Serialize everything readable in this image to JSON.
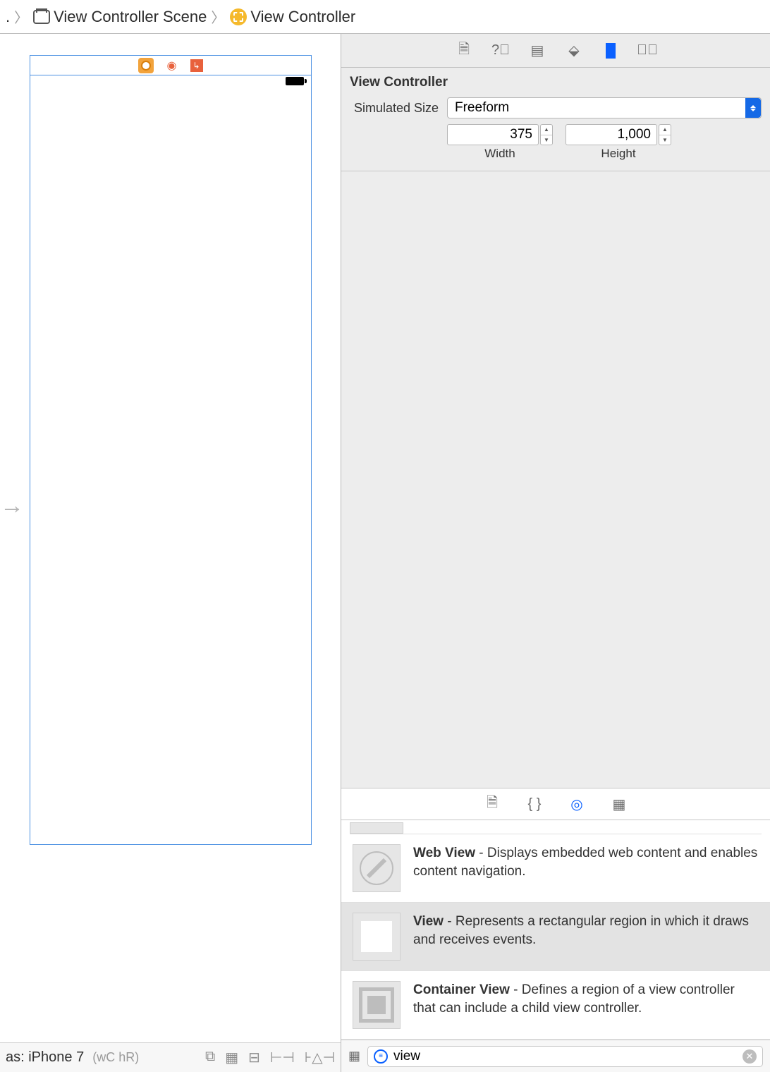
{
  "breadcrumb": {
    "leading_sep": ".",
    "scene": "View Controller Scene",
    "item": "View Controller"
  },
  "canvas": {
    "footer_device": "as: iPhone 7",
    "footer_traits": "(wC hR)"
  },
  "inspector": {
    "title": "View Controller",
    "sim_size_label": "Simulated Size",
    "sim_size_value": "Freeform",
    "width_value": "375",
    "height_value": "1,000",
    "width_label": "Width",
    "height_label": "Height"
  },
  "library": {
    "items": [
      {
        "name": "Web View",
        "desc": " - Displays embedded web content and enables content navigation."
      },
      {
        "name": "View",
        "desc": " - Represents a rectangular region in which it draws and receives events."
      },
      {
        "name": "Container View",
        "desc": " - Defines a region of a view controller that can include a child view controller."
      }
    ],
    "search_value": "view"
  }
}
